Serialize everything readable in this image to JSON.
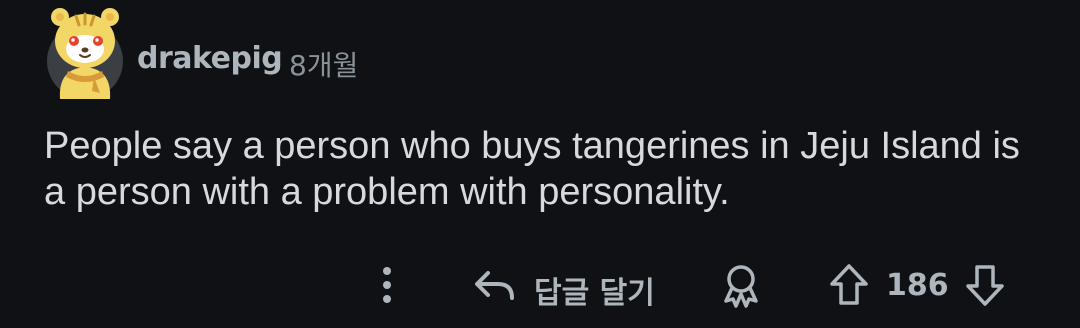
{
  "comment": {
    "author": "drakepig",
    "timestamp": "8개월",
    "body": "People say a person who buys tangerines in Jeju Island is a person with a problem with personality.",
    "actions": {
      "reply_label": "답글 달기",
      "vote_count": "186"
    }
  },
  "icons": [
    "avatar",
    "more-vertical-icon",
    "reply-arrow-icon",
    "award-icon",
    "upvote-arrow-icon",
    "downvote-arrow-icon"
  ],
  "colors": {
    "background": "#0f1114",
    "text_primary": "#d7dadc",
    "text_secondary": "#aeb6bd",
    "avatar_yellow": "#f3d766"
  }
}
